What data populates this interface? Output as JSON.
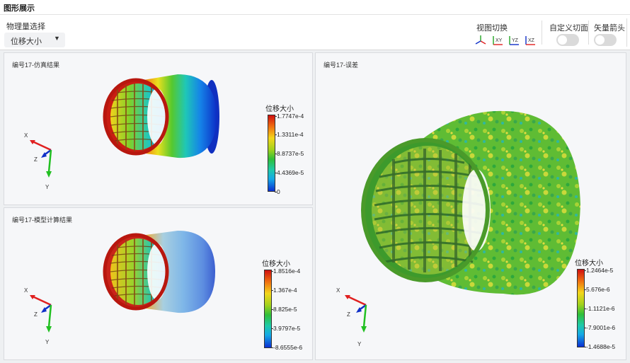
{
  "header": {
    "title": "图形展示"
  },
  "controls": {
    "physical_quantity_label": "物理量选择",
    "physical_quantity_value": "位移大小",
    "view_switch_label": "视图切换",
    "view_icons": [
      {
        "name": "iso-view-icon",
        "label": ""
      },
      {
        "name": "xy-view-icon",
        "label": "XY"
      },
      {
        "name": "yz-view-icon",
        "label": "YZ"
      },
      {
        "name": "xz-view-icon",
        "label": "XZ"
      }
    ],
    "custom_section_label": "自定义切面",
    "custom_section_on": false,
    "vector_arrow_label": "矢量箭头",
    "vector_arrow_on": false
  },
  "panels": {
    "simulation": {
      "title": "编号17-仿真结果",
      "legend_title": "位移大小",
      "legend_ticks": [
        "1.7747e-4",
        "1.3311e-4",
        "8.8737e-5",
        "4.4369e-5",
        "0"
      ]
    },
    "model": {
      "title": "编号17-模型计算结果",
      "legend_title": "位移大小",
      "legend_ticks": [
        "1.8516e-4",
        "1.367e-4",
        "8.825e-5",
        "3.9797e-5",
        "-8.6555e-6"
      ]
    },
    "error": {
      "title": "编号17-误差",
      "legend_title": "位移大小",
      "legend_ticks": [
        "1.2464e-5",
        "5.676e-6",
        "-1.1121e-6",
        "-7.9001e-6",
        "-1.4688e-5"
      ]
    }
  },
  "axes": {
    "x": "X",
    "y": "Y",
    "z": "Z"
  },
  "colors": {
    "x_axis": "#e02020",
    "y_axis": "#22c022",
    "z_axis": "#1030c8",
    "legend_max": "#d01010",
    "legend_min": "#0b2fd2"
  }
}
